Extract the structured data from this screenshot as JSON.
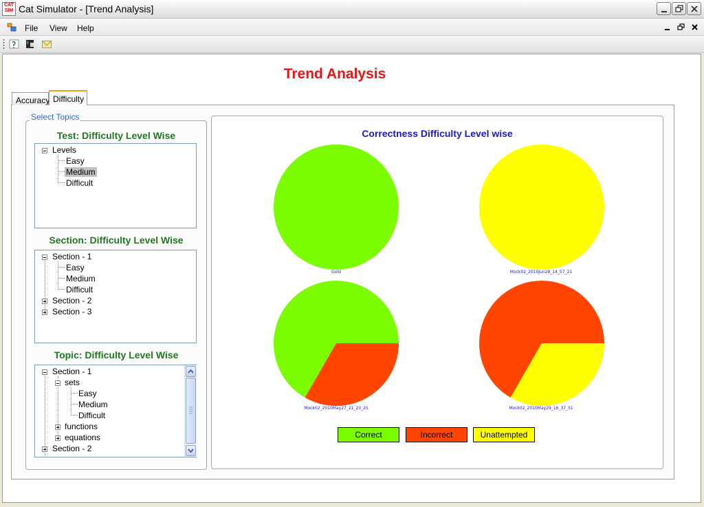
{
  "window": {
    "title": "Cat Simulator - [Trend Analysis]",
    "icon_text_top": "CAT",
    "icon_text_bottom": "SIM"
  },
  "menu": {
    "items": [
      "File",
      "View",
      "Help"
    ]
  },
  "toolbar": {
    "icons": [
      "help-icon",
      "cat-icon",
      "mail-icon"
    ]
  },
  "page": {
    "title": "Trend Analysis"
  },
  "tabs": [
    {
      "label": "Accuracy",
      "active": false
    },
    {
      "label": "Difficulty",
      "active": true
    }
  ],
  "select_topics": {
    "legend": "Select Topics",
    "test": {
      "heading": "Test: Difficulty Level Wise",
      "root": "Levels",
      "children": [
        "Easy",
        "Medium",
        "Difficult"
      ],
      "selected": "Medium"
    },
    "section": {
      "heading": "Section: Difficulty Level Wise",
      "nodes": [
        "Section - 1",
        "Easy",
        "Medium",
        "Difficult",
        "Section - 2",
        "Section - 3"
      ]
    },
    "topic": {
      "heading": "Topic: Difficulty Level Wise",
      "nodes": [
        "Section - 1",
        "sets",
        "Easy",
        "Medium",
        "Difficult",
        "functions",
        "equations",
        "Section - 2"
      ]
    }
  },
  "colors": {
    "correct": "#7cfc00",
    "incorrect": "#ff4500",
    "unattempted": "#ffff00"
  },
  "chart_data": {
    "type": "pie",
    "title": "Correctness Difficulty Level wise",
    "legend": [
      "Correct",
      "Incorrect",
      "Unattempted"
    ],
    "legend_placement": "bottom",
    "pies": [
      {
        "label": "Gold",
        "slices": [
          {
            "name": "Correct",
            "value": 100
          },
          {
            "name": "Incorrect",
            "value": 0
          },
          {
            "name": "Unattempted",
            "value": 0
          }
        ]
      },
      {
        "label": "Mock02_2010Jun28_14_57_21",
        "slices": [
          {
            "name": "Correct",
            "value": 0
          },
          {
            "name": "Incorrect",
            "value": 0
          },
          {
            "name": "Unattempted",
            "value": 100
          }
        ]
      },
      {
        "label": "Mock02_2010May27_21_23_25",
        "slices": [
          {
            "name": "Correct",
            "value": 66.7
          },
          {
            "name": "Incorrect",
            "value": 33.3
          },
          {
            "name": "Unattempted",
            "value": 0
          }
        ]
      },
      {
        "label": "Mock02_2010May29_16_37_51",
        "slices": [
          {
            "name": "Correct",
            "value": 0
          },
          {
            "name": "Incorrect",
            "value": 66.7
          },
          {
            "name": "Unattempted",
            "value": 33.3
          }
        ]
      }
    ]
  }
}
